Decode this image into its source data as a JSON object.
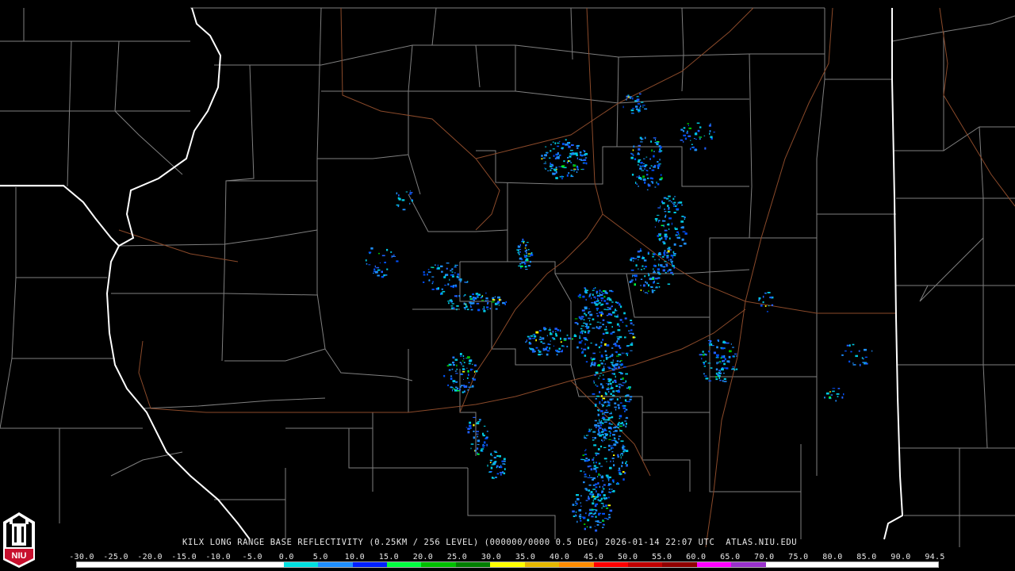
{
  "title": "KILX LONG RANGE BASE REFLECTIVITY (0.25KM / 256 LEVEL) (000000/0000 0.5 DEG) 2026-01-14 22:07 UTC  ATLAS.NIU.EDU",
  "logo_text": "NIU",
  "colors": {
    "background": "#000000",
    "county_lines": "#8a8a8a",
    "state_lines": "#ffffff",
    "highways": "#8b4a2a",
    "logo_red": "#c8102e"
  },
  "colorbar": {
    "labels": [
      "-30.0",
      "-25.0",
      "-20.0",
      "-15.0",
      "-10.0",
      "-5.0",
      "0.0",
      "5.0",
      "10.0",
      "15.0",
      "20.0",
      "25.0",
      "30.0",
      "35.0",
      "40.0",
      "45.0",
      "50.0",
      "55.0",
      "60.0",
      "65.0",
      "70.0",
      "75.0",
      "80.0",
      "85.0",
      "90.0",
      "94.5"
    ],
    "colors": [
      "#ffffff",
      "#ffffff",
      "#ffffff",
      "#ffffff",
      "#ffffff",
      "#ffffff",
      "#00e0e0",
      "#1e8fff",
      "#0020ff",
      "#00ff40",
      "#00c000",
      "#008000",
      "#ffff00",
      "#e6b800",
      "#ff8c00",
      "#ff0000",
      "#c00000",
      "#900000",
      "#ff00ff",
      "#9932cc",
      "#ffffff",
      "#ffffff",
      "#ffffff",
      "#ffffff",
      "#ffffff"
    ]
  }
}
